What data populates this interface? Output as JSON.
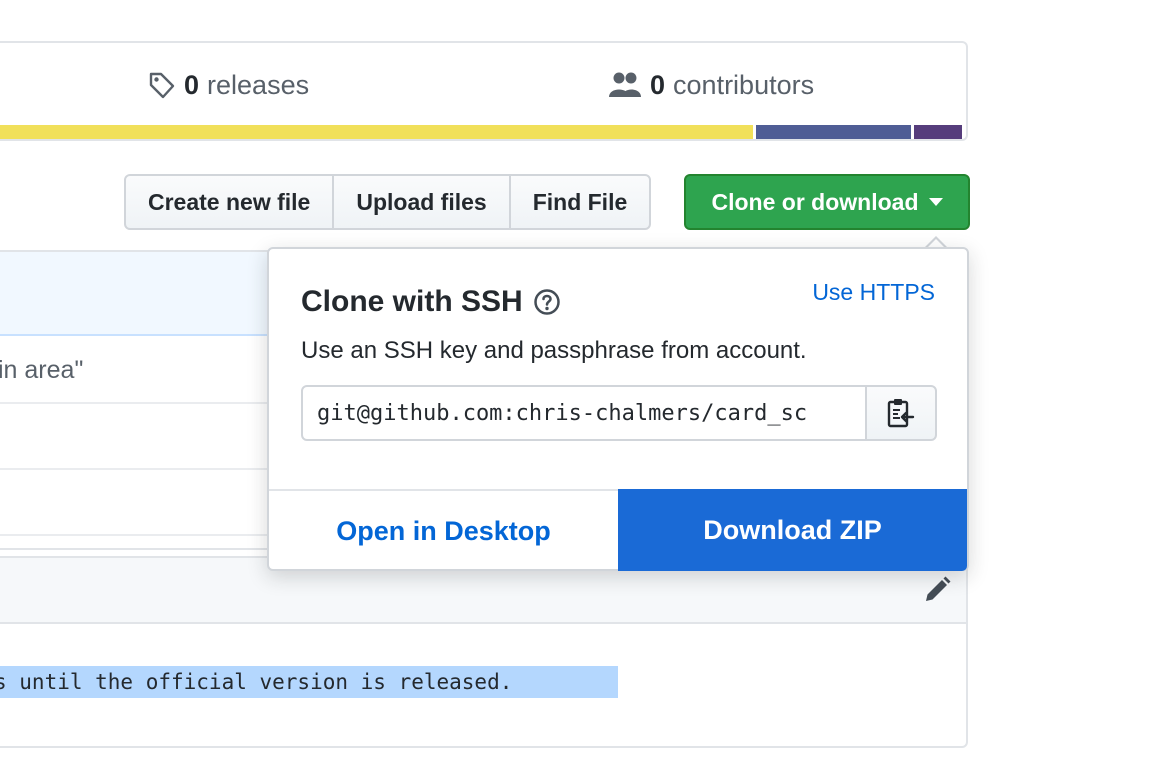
{
  "summary": {
    "releases_count": "0",
    "releases_label": "releases",
    "contributors_count": "0",
    "contributors_label": "contributors",
    "language_colors": [
      "#f1e05a",
      "#4f5d95",
      "#563d7c"
    ],
    "language_shares": [
      0.78,
      0.16,
      0.05
    ]
  },
  "toolbar": {
    "create_label": "Create new file",
    "upload_label": "Upload files",
    "find_label": "Find File",
    "clone_label": "Clone or download"
  },
  "file_list": {
    "row1_text": "in area\""
  },
  "readme": {
    "highlight_text": "s until the official version is released."
  },
  "clone_panel": {
    "title": "Clone with SSH",
    "switch_label": "Use HTTPS",
    "description": "Use an SSH key and passphrase from account.",
    "url_value": "git@github.com:chris-chalmers/card_sc",
    "open_desktop_label": "Open in Desktop",
    "download_zip_label": "Download ZIP"
  },
  "colors": {
    "green": "#2ea44f",
    "blue": "#1a6ad6",
    "link": "#0366d6",
    "highlight": "#b4d7fe"
  },
  "icons": [
    "tag-icon",
    "people-icon",
    "help-icon",
    "clipboard-icon",
    "pencil-icon",
    "caret-down-icon"
  ]
}
